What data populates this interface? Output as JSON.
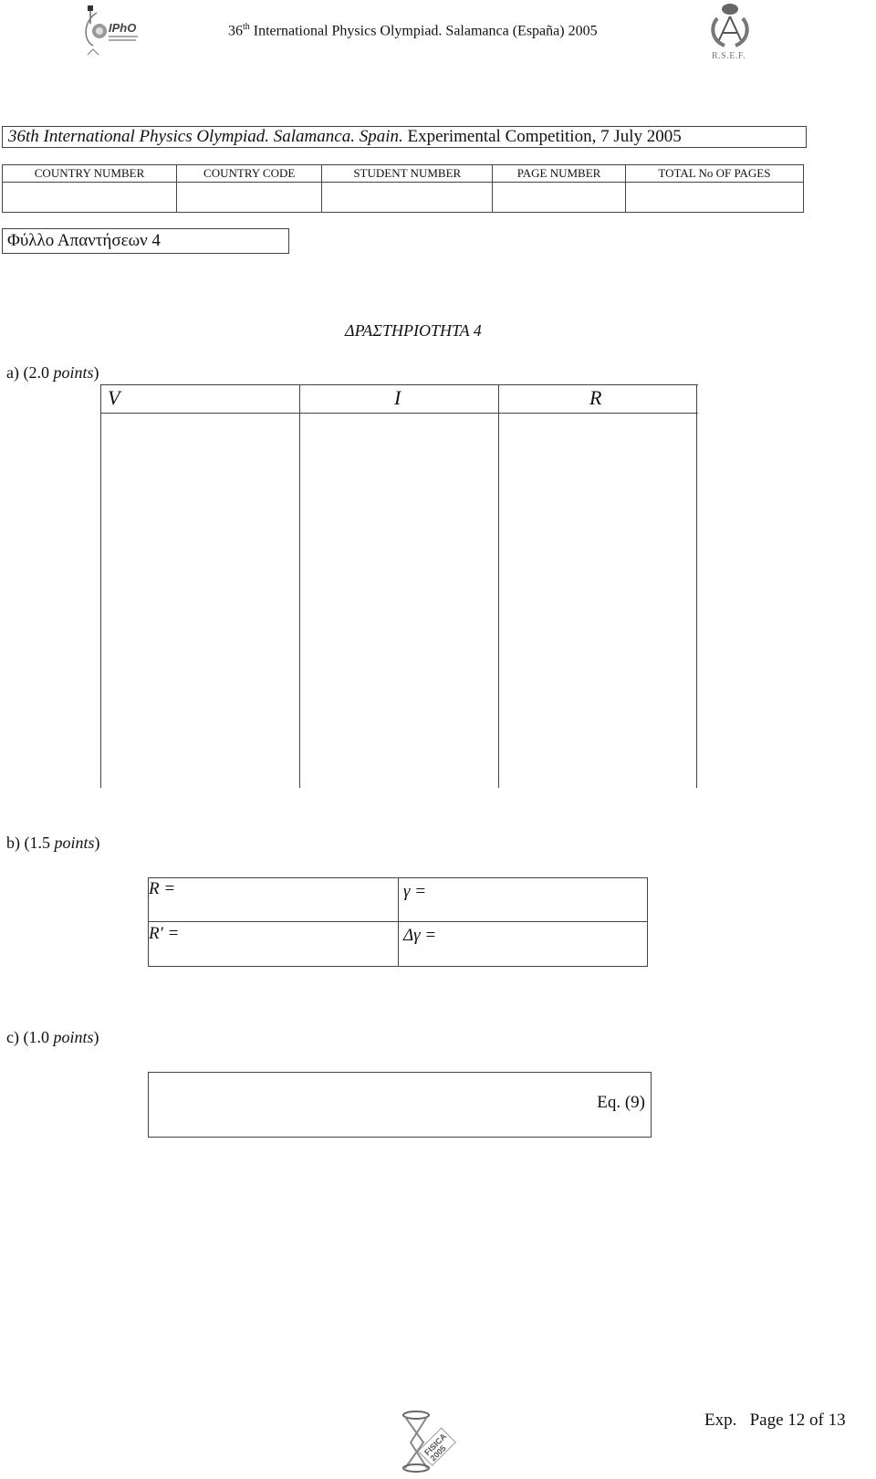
{
  "header": {
    "title_prefix": "36",
    "title_sup": "th",
    "title_rest": " International Physics Olympiad. Salamanca (España) 2005",
    "left_logo": "ipho-logo",
    "left_logo_text": "IPhO",
    "right_logo": "rsef-crest-logo",
    "right_logo_caption": "R.S.E.F."
  },
  "banner": {
    "italic_part": "36th International Physics Olympiad. Salamanca. Spain.",
    "normal_part": " Experimental Competition,  7 July 2005"
  },
  "id_table": {
    "columns": [
      "COUNTRY NUMBER",
      "COUNTRY CODE",
      "STUDENT NUMBER",
      "PAGE NUMBER",
      "TOTAL No OF PAGES"
    ],
    "values": [
      "",
      "",
      "",
      "",
      ""
    ]
  },
  "answer_sheet_label": "Φύλλο Απαντήσεων  4",
  "activity_title": "ΔΡΑΣΤΗΡΙΟΤΗΤΑ 4",
  "part_a": {
    "prefix": "a) (2.0 ",
    "points_word": "points",
    "suffix": ")",
    "table_headers": [
      "V",
      "I",
      "R"
    ]
  },
  "part_b": {
    "prefix": "b) (1.5 ",
    "points_word": "points",
    "suffix": ")",
    "cells": [
      "R =",
      "γ =",
      "R′ =",
      "Δγ ="
    ]
  },
  "part_c": {
    "prefix": "c) (1.0 ",
    "points_word": "points",
    "suffix": ")",
    "equation_label": "Eq. (9)"
  },
  "footer": {
    "logo": "fisica-2005-logo",
    "page_label": "Exp.   Page 12 of 13"
  }
}
